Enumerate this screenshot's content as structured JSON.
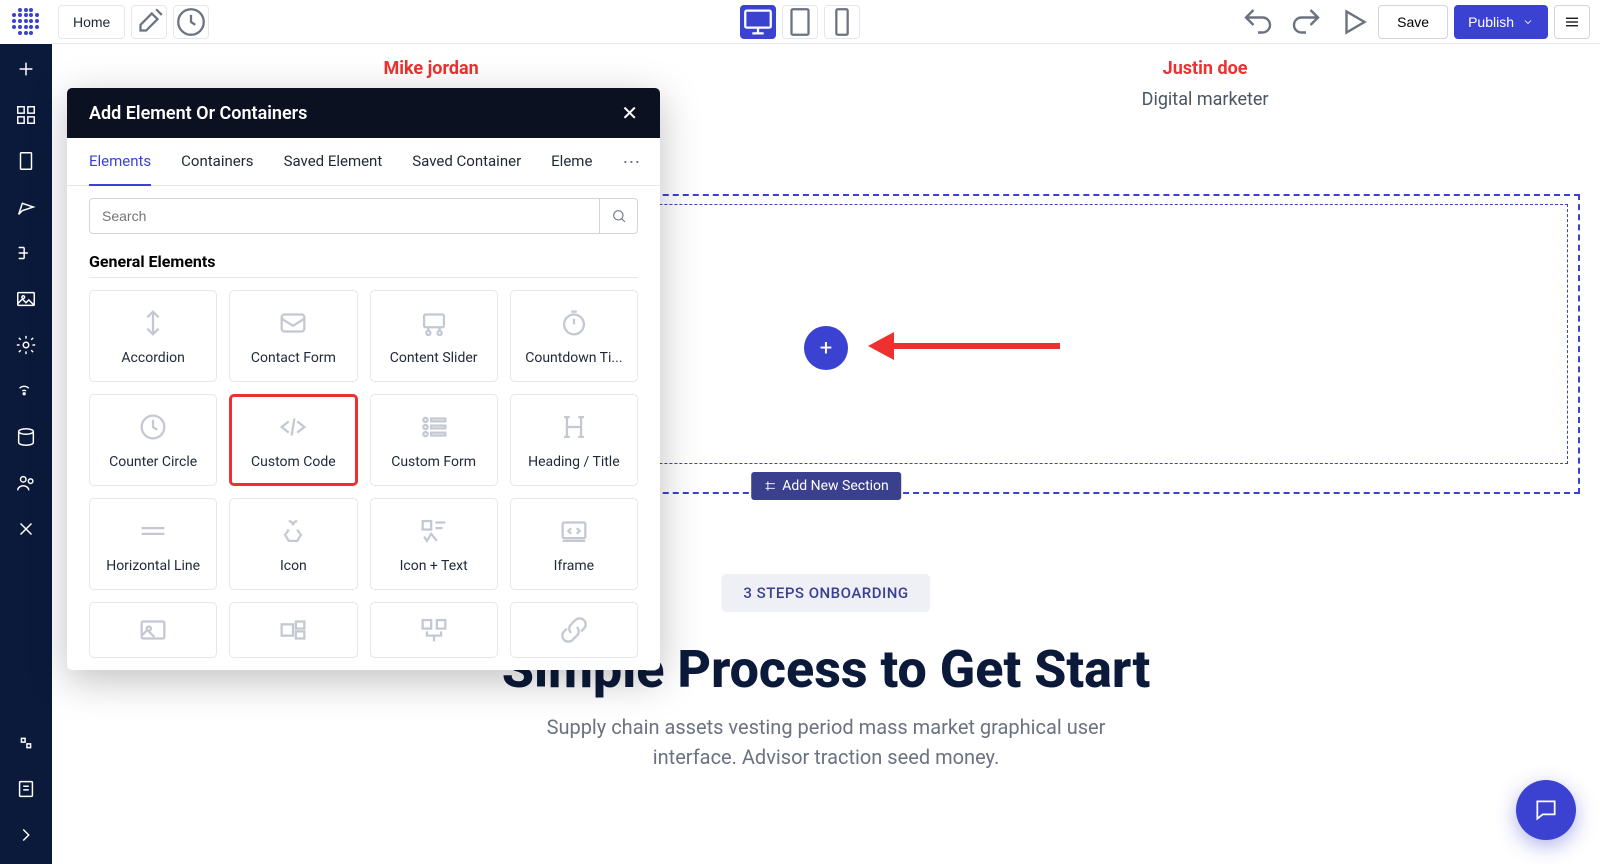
{
  "toolbar": {
    "home_label": "Home",
    "save_label": "Save",
    "publish_label": "Publish"
  },
  "names": {
    "left": "Mike jordan",
    "right": "Justin doe",
    "right_sub": "Digital marketer"
  },
  "section": {
    "add_section_label": "Add New Section"
  },
  "hero": {
    "pill": "3 STEPS ONBOARDING",
    "title": "Simple Process to Get Start",
    "subtitle": "Supply chain assets vesting period mass market graphical user interface. Advisor traction seed money."
  },
  "modal": {
    "title": "Add Element Or Containers",
    "tabs": [
      "Elements",
      "Containers",
      "Saved Element",
      "Saved Container",
      "Eleme"
    ],
    "active_tab": 0,
    "search_placeholder": "Search",
    "section_title": "General Elements",
    "elements": [
      "Accordion",
      "Contact Form",
      "Content Slider",
      "Countdown Ti...",
      "Counter Circle",
      "Custom Code",
      "Custom Form",
      "Heading / Title",
      "Horizontal Line",
      "Icon",
      "Icon + Text",
      "Iframe"
    ],
    "highlighted": "Custom Code"
  }
}
